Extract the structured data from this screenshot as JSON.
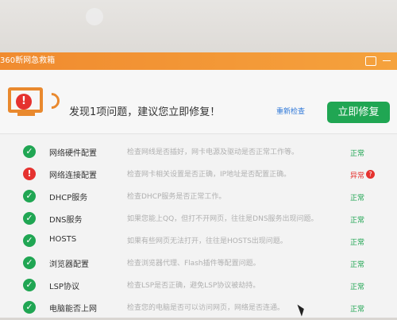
{
  "window": {
    "title": "360断网急救箱"
  },
  "header": {
    "headline": "发现1项问题，建议您立即修复！",
    "recheck_label": "重新检查",
    "fix_label": "立即修复"
  },
  "items": [
    {
      "name": "网络硬件配置",
      "desc": "检查网线是否插好，网卡电源及驱动是否正常工作等。",
      "status": "正常",
      "ok": true
    },
    {
      "name": "网络连接配置",
      "desc": "检查网卡相关设置是否正确，IP地址是否配置正确。",
      "status": "异常",
      "ok": false
    },
    {
      "name": "DHCP服务",
      "desc": "检查DHCP服务是否正常工作。",
      "status": "正常",
      "ok": true
    },
    {
      "name": "DNS服务",
      "desc": "如果您能上QQ，但打不开网页，往往是DNS服务出现问题。",
      "status": "正常",
      "ok": true
    },
    {
      "name": "HOSTS",
      "desc": "如果有些网页无法打开，往往是HOSTS出现问题。",
      "status": "正常",
      "ok": true
    },
    {
      "name": "浏览器配置",
      "desc": "检查浏览器代理、Flash插件等配置问题。",
      "status": "正常",
      "ok": true
    },
    {
      "name": "LSP协议",
      "desc": "检查LSP是否正确，避免LSP协议被劫持。",
      "status": "正常",
      "ok": true
    },
    {
      "name": "电脑能否上网",
      "desc": "检查您的电脑是否可以访问网页，网络是否连通。",
      "status": "正常",
      "ok": true
    }
  ],
  "icons": {
    "ok": "check-circle-icon",
    "error": "alert-circle-icon",
    "help": "question-icon"
  },
  "colors": {
    "accent": "#f08b2f",
    "ok": "#20a653",
    "error": "#e5322f",
    "link": "#2f78d8"
  }
}
